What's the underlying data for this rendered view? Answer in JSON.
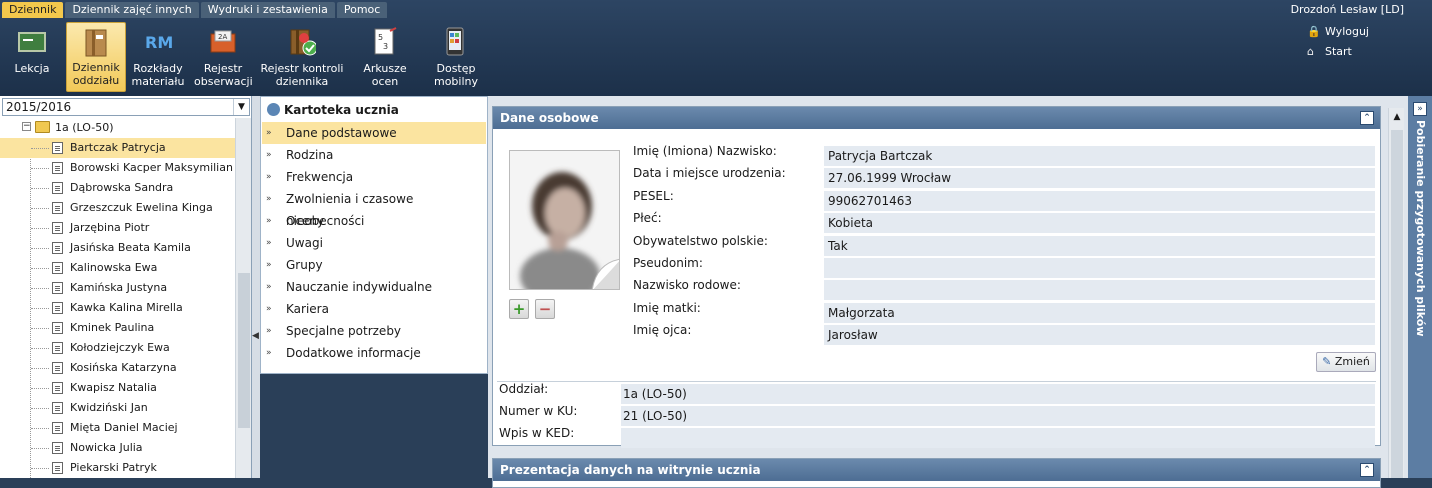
{
  "menu_tabs": [
    "Dziennik",
    "Dziennik zajęć innych",
    "Wydruki i zestawienia",
    "Pomoc"
  ],
  "user_name": "Drozdoń Lesław [LD]",
  "toolbar": [
    {
      "label": "Lekcja",
      "icon": "lesson-icon"
    },
    {
      "label": "Dziennik\noddziału",
      "icon": "class-journal-icon",
      "active": true
    },
    {
      "label": "Rozkłady\nmateriału",
      "icon": "rm-icon"
    },
    {
      "label": "Rejestr\nobserwacji",
      "icon": "observation-register-icon"
    },
    {
      "label": "Rejestr kontroli\ndziennika",
      "icon": "control-register-icon"
    },
    {
      "label": "Arkusze\nocen",
      "icon": "grade-sheets-icon"
    },
    {
      "label": "Dostęp\nmobilny",
      "icon": "mobile-access-icon"
    }
  ],
  "right_links": {
    "logout": "Wyloguj",
    "start": "Start"
  },
  "year_select": "2015/2016",
  "tree": {
    "class_label": "1a (LO-50)",
    "students": [
      "Bartczak Patrycja",
      "Borowski Kacper Maksymilian",
      "Dąbrowska Sandra",
      "Grzeszczuk Ewelina Kinga",
      "Jarzębina Piotr",
      "Jasińska Beata Kamila",
      "Kalinowska Ewa",
      "Kamińska Justyna",
      "Kawka Kalina Mirella",
      "Kminek Paulina",
      "Kołodziejczyk Ewa",
      "Kosińska Katarzyna",
      "Kwapisz Natalia",
      "Kwidziński Jan",
      "Mięta Daniel Maciej",
      "Nowicka Julia",
      "Piekarski Patryk"
    ],
    "selected": "Bartczak Patrycja"
  },
  "nav": {
    "title": "Kartoteka ucznia",
    "items": [
      "Dane podstawowe",
      "Rodzina",
      "Frekwencja",
      "Zwolnienia i czasowe nieobecności",
      "Oceny",
      "Uwagi",
      "Grupy",
      "Nauczanie indywidualne",
      "Kariera",
      "Specjalne potrzeby",
      "Dodatkowe informacje"
    ],
    "selected": "Dane podstawowe"
  },
  "personal": {
    "title": "Dane osobowe",
    "fields": [
      {
        "label": "Imię (Imiona) Nazwisko:",
        "value": "Patrycja Bartczak"
      },
      {
        "label": "Data i miejsce urodzenia:",
        "value": "27.06.1999 Wrocław"
      },
      {
        "label": "PESEL:",
        "value": "99062701463"
      },
      {
        "label": "Płeć:",
        "value": "Kobieta"
      },
      {
        "label": "Obywatelstwo polskie:",
        "value": "Tak"
      },
      {
        "label": "Pseudonim:",
        "value": ""
      },
      {
        "label": "Nazwisko rodowe:",
        "value": ""
      },
      {
        "label": "Imię matki:",
        "value": "Małgorzata"
      },
      {
        "label": "Imię ojca:",
        "value": "Jarosław"
      }
    ],
    "change_button": "Zmień",
    "other": [
      {
        "label": "Oddział:",
        "value": "1a (LO-50)"
      },
      {
        "label": "Numer w KU:",
        "value": "21 (LO-50)"
      },
      {
        "label": "Wpis w KED:",
        "value": ""
      }
    ]
  },
  "presentation": {
    "title": "Prezentacja danych na witrynie ucznia"
  },
  "side_panel": {
    "title": "Pobieranie przygotowanych plików"
  }
}
